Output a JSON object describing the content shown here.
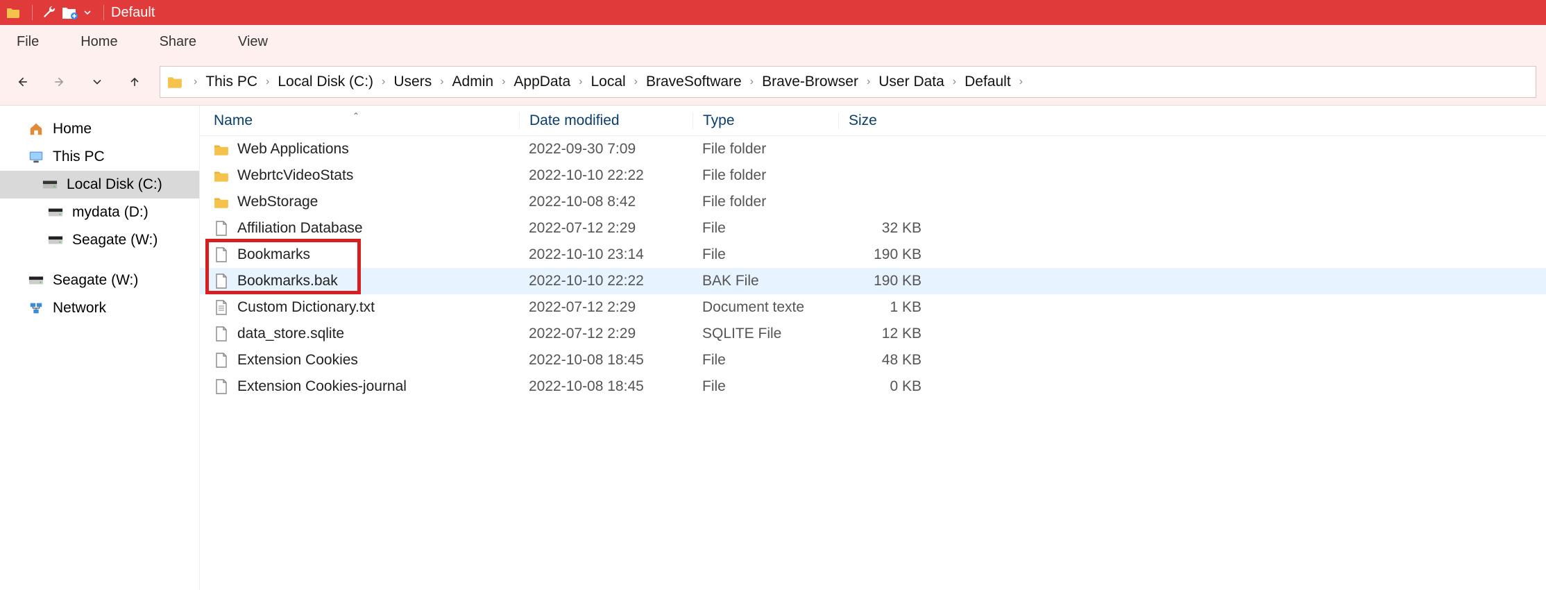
{
  "titlebar": {
    "title": "Default"
  },
  "ribbon": {
    "tabs": [
      "File",
      "Home",
      "Share",
      "View"
    ]
  },
  "breadcrumb": [
    "This PC",
    "Local Disk (C:)",
    "Users",
    "Admin",
    "AppData",
    "Local",
    "BraveSoftware",
    "Brave-Browser",
    "User Data",
    "Default"
  ],
  "sidebar": {
    "items": [
      {
        "label": "Home",
        "icon": "home",
        "indent": 1
      },
      {
        "label": "This PC",
        "icon": "pc",
        "indent": 1
      },
      {
        "label": "Local Disk (C:)",
        "icon": "disk",
        "indent": 2,
        "selected": true
      },
      {
        "label": "mydata (D:)",
        "icon": "drive",
        "indent": 3
      },
      {
        "label": "Seagate (W:)",
        "icon": "drive",
        "indent": 3
      },
      {
        "label": "Seagate (W:)",
        "icon": "drive",
        "indent": 1
      },
      {
        "label": "Network",
        "icon": "network",
        "indent": 1
      }
    ]
  },
  "columns": {
    "name": "Name",
    "date": "Date modified",
    "type": "Type",
    "size": "Size"
  },
  "files": [
    {
      "icon": "folder",
      "name": "Web Applications",
      "date": "2022-09-30 7:09",
      "type": "File folder",
      "size": ""
    },
    {
      "icon": "folder",
      "name": "WebrtcVideoStats",
      "date": "2022-10-10 22:22",
      "type": "File folder",
      "size": ""
    },
    {
      "icon": "folder",
      "name": "WebStorage",
      "date": "2022-10-08 8:42",
      "type": "File folder",
      "size": ""
    },
    {
      "icon": "file",
      "name": "Affiliation Database",
      "date": "2022-07-12 2:29",
      "type": "File",
      "size": "32 KB"
    },
    {
      "icon": "file",
      "name": "Bookmarks",
      "date": "2022-10-10 23:14",
      "type": "File",
      "size": "190 KB"
    },
    {
      "icon": "file",
      "name": "Bookmarks.bak",
      "date": "2022-10-10 22:22",
      "type": "BAK File",
      "size": "190 KB",
      "highlight": true
    },
    {
      "icon": "textfile",
      "name": "Custom Dictionary.txt",
      "date": "2022-07-12 2:29",
      "type": "Document texte",
      "size": "1 KB"
    },
    {
      "icon": "file",
      "name": "data_store.sqlite",
      "date": "2022-07-12 2:29",
      "type": "SQLITE File",
      "size": "12 KB"
    },
    {
      "icon": "file",
      "name": "Extension Cookies",
      "date": "2022-10-08 18:45",
      "type": "File",
      "size": "48 KB"
    },
    {
      "icon": "file",
      "name": "Extension Cookies-journal",
      "date": "2022-10-08 18:45",
      "type": "File",
      "size": "0 KB"
    }
  ],
  "redbox": {
    "top_row": 4,
    "bottom_row": 5
  }
}
